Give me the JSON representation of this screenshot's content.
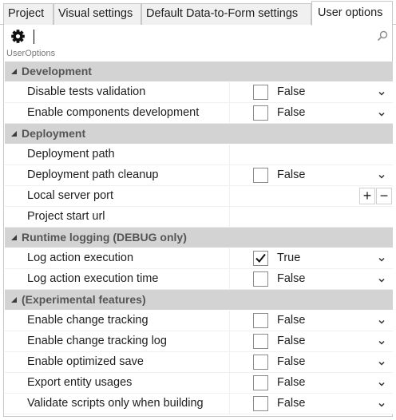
{
  "tabs": [
    {
      "label": "Project"
    },
    {
      "label": "Visual settings"
    },
    {
      "label": "Default Data-to-Form settings"
    },
    {
      "label": "User options",
      "active": true
    }
  ],
  "toolbar": {
    "settings_icon": "gear-icon",
    "search_icon": "search-icon"
  },
  "object_name": "UserOptions",
  "categories": [
    {
      "label": "Development",
      "props": [
        {
          "name": "Disable tests validation",
          "type": "bool",
          "checked": false,
          "value": "False"
        },
        {
          "name": "Enable components development",
          "type": "bool",
          "checked": false,
          "value": "False"
        }
      ]
    },
    {
      "label": "Deployment",
      "props": [
        {
          "name": "Deployment path",
          "type": "text",
          "value": ""
        },
        {
          "name": "Deployment path cleanup",
          "type": "bool",
          "checked": false,
          "value": "False"
        },
        {
          "name": "Local server port",
          "type": "number",
          "value": "",
          "plus": "+",
          "minus": "−"
        },
        {
          "name": "Project start url",
          "type": "text",
          "value": ""
        }
      ]
    },
    {
      "label": "Runtime logging (DEBUG only)",
      "props": [
        {
          "name": "Log action execution",
          "type": "bool",
          "checked": true,
          "value": "True"
        },
        {
          "name": "Log action execution time",
          "type": "bool",
          "checked": false,
          "value": "False"
        }
      ]
    },
    {
      "label": "(Experimental features)",
      "props": [
        {
          "name": "Enable change tracking",
          "type": "bool",
          "checked": false,
          "value": "False"
        },
        {
          "name": "Enable change tracking log",
          "type": "bool",
          "checked": false,
          "value": "False"
        },
        {
          "name": "Enable optimized save",
          "type": "bool",
          "checked": false,
          "value": "False"
        },
        {
          "name": "Export entity usages",
          "type": "bool",
          "checked": false,
          "value": "False"
        },
        {
          "name": "Validate scripts only when building",
          "type": "bool",
          "checked": false,
          "value": "False"
        }
      ]
    }
  ]
}
